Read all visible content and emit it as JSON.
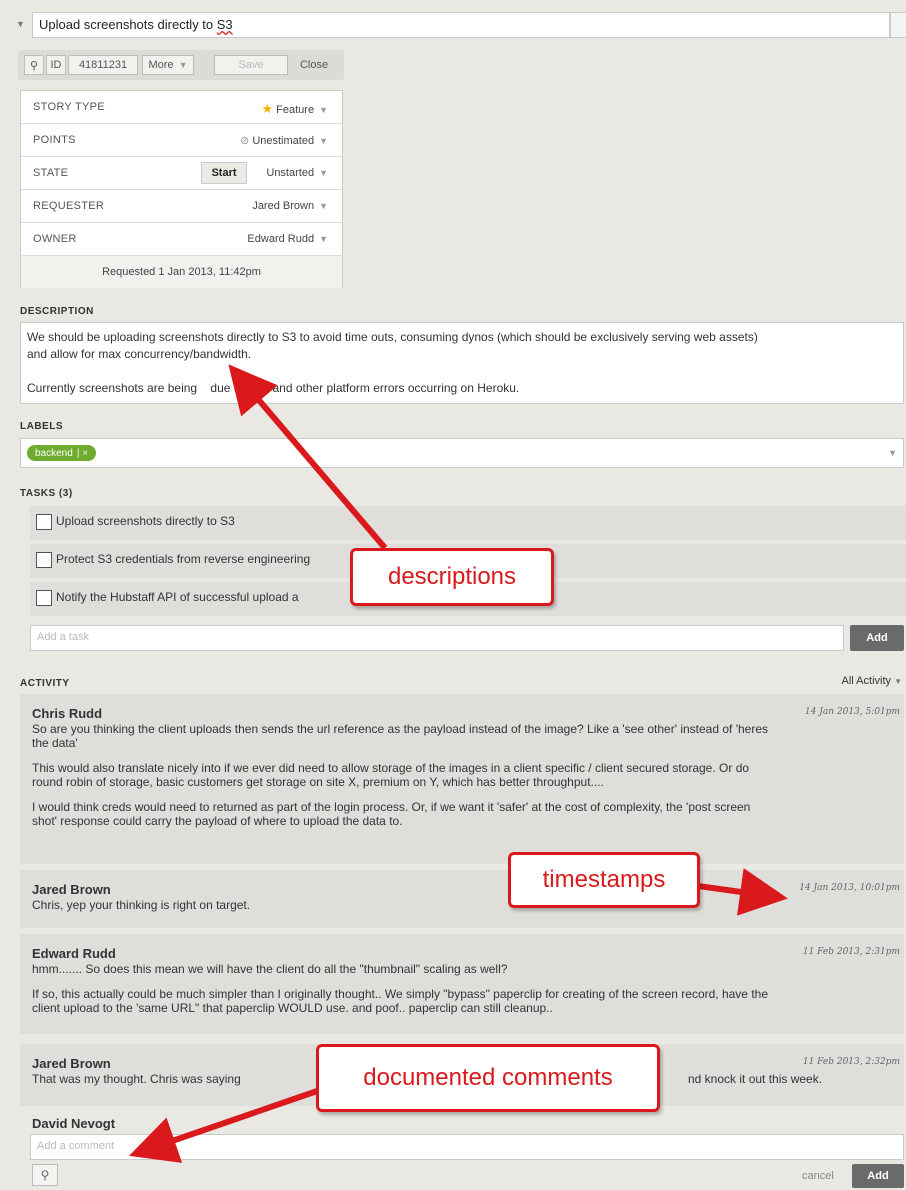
{
  "story": {
    "title": "Upload screenshots directly to S3",
    "title_prefix": "Upload screenshots directly to ",
    "title_suffix": "S3",
    "id_label": "ID",
    "id_value": "41811231",
    "more_label": "More",
    "save_label": "Save",
    "close_label": "Close"
  },
  "info": {
    "story_type": {
      "label": "STORY TYPE",
      "value": "Feature"
    },
    "points": {
      "label": "POINTS",
      "value": "Unestimated"
    },
    "state": {
      "label": "STATE",
      "start_label": "Start",
      "value": "Unstarted"
    },
    "requester": {
      "label": "REQUESTER",
      "value": "Jared Brown"
    },
    "owner": {
      "label": "OWNER",
      "value": "Edward Rudd"
    },
    "requested_text": "Requested 1 Jan 2013, 11:42pm"
  },
  "description": {
    "heading": "DESCRIPTION",
    "line1": "We should be uploading screenshots directly to S3 to avoid time outs, consuming dynos (which should be exclusively serving web assets)",
    "line2": "and allow for max concurrency/bandwidth.",
    "line3": "Currently screenshots are being    due to H12 and other platform errors occurring on Heroku."
  },
  "labels": {
    "heading": "LABELS",
    "chips": [
      "backend"
    ]
  },
  "tasks": {
    "heading": "TASKS (3)",
    "items": [
      "Upload screenshots directly to S3",
      "Protect S3 credentials from reverse engineering",
      "Notify the Hubstaff API of successful upload a"
    ],
    "add_placeholder": "Add a task",
    "add_label": "Add"
  },
  "activity": {
    "heading": "ACTIVITY",
    "filter": "All Activity",
    "comments": [
      {
        "author": "Chris Rudd",
        "time": "14 Jan 2013, 5:01pm",
        "p1a": "So are you thinking the client uploads then sends the url reference as the payload instead of the image? Like a 'see other' instead of 'heres",
        "p1b": "the data'",
        "p2a": "This would also translate nicely into if we ever did need to allow storage of the images in a client specific / client secured storage. Or do",
        "p2b": "round robin of storage, basic customers get storage on site X, premium on Y, which has better throughput....",
        "p3a": "I would think creds would need to returned as part of the login process. Or, if we want it 'safer' at the cost of complexity, the 'post screen",
        "p3b": "shot' response could carry the payload of where to upload the data to."
      },
      {
        "author": "Jared Brown",
        "time": "14 Jan 2013, 10:01pm",
        "p1a": "Chris, yep your thinking is right on target."
      },
      {
        "author": "Edward Rudd",
        "time": "11 Feb 2013, 2:31pm",
        "p1a": "hmm....... So does this mean we will have the client do all the \"thumbnail\" scaling as well?",
        "p2a": "If so, this actually could be much simpler than I originally thought.. We simply \"bypass\" paperclip for creating of the screen record, have the",
        "p2b": "client upload to the 'same URL\" that paperclip WOULD use. and poof.. paperclip can still cleanup.."
      },
      {
        "author": "Jared Brown",
        "time": "11 Feb 2013, 2:32pm",
        "p1a_left": "That was my thought. Chris was saying",
        "p1a_right": "nd knock it out this week."
      }
    ],
    "new_comment": {
      "author": "David Nevogt",
      "placeholder": "Add a comment",
      "cancel_label": "cancel",
      "add_label": "Add"
    }
  },
  "annotations": {
    "descriptions": "descriptions",
    "timestamps": "timestamps",
    "documented_comments": "documented comments",
    "color": "#d9191b"
  },
  "colors": {
    "panel_bg": "#e9e8e3",
    "label_green": "#6fab2e",
    "star": "#f0b400"
  }
}
